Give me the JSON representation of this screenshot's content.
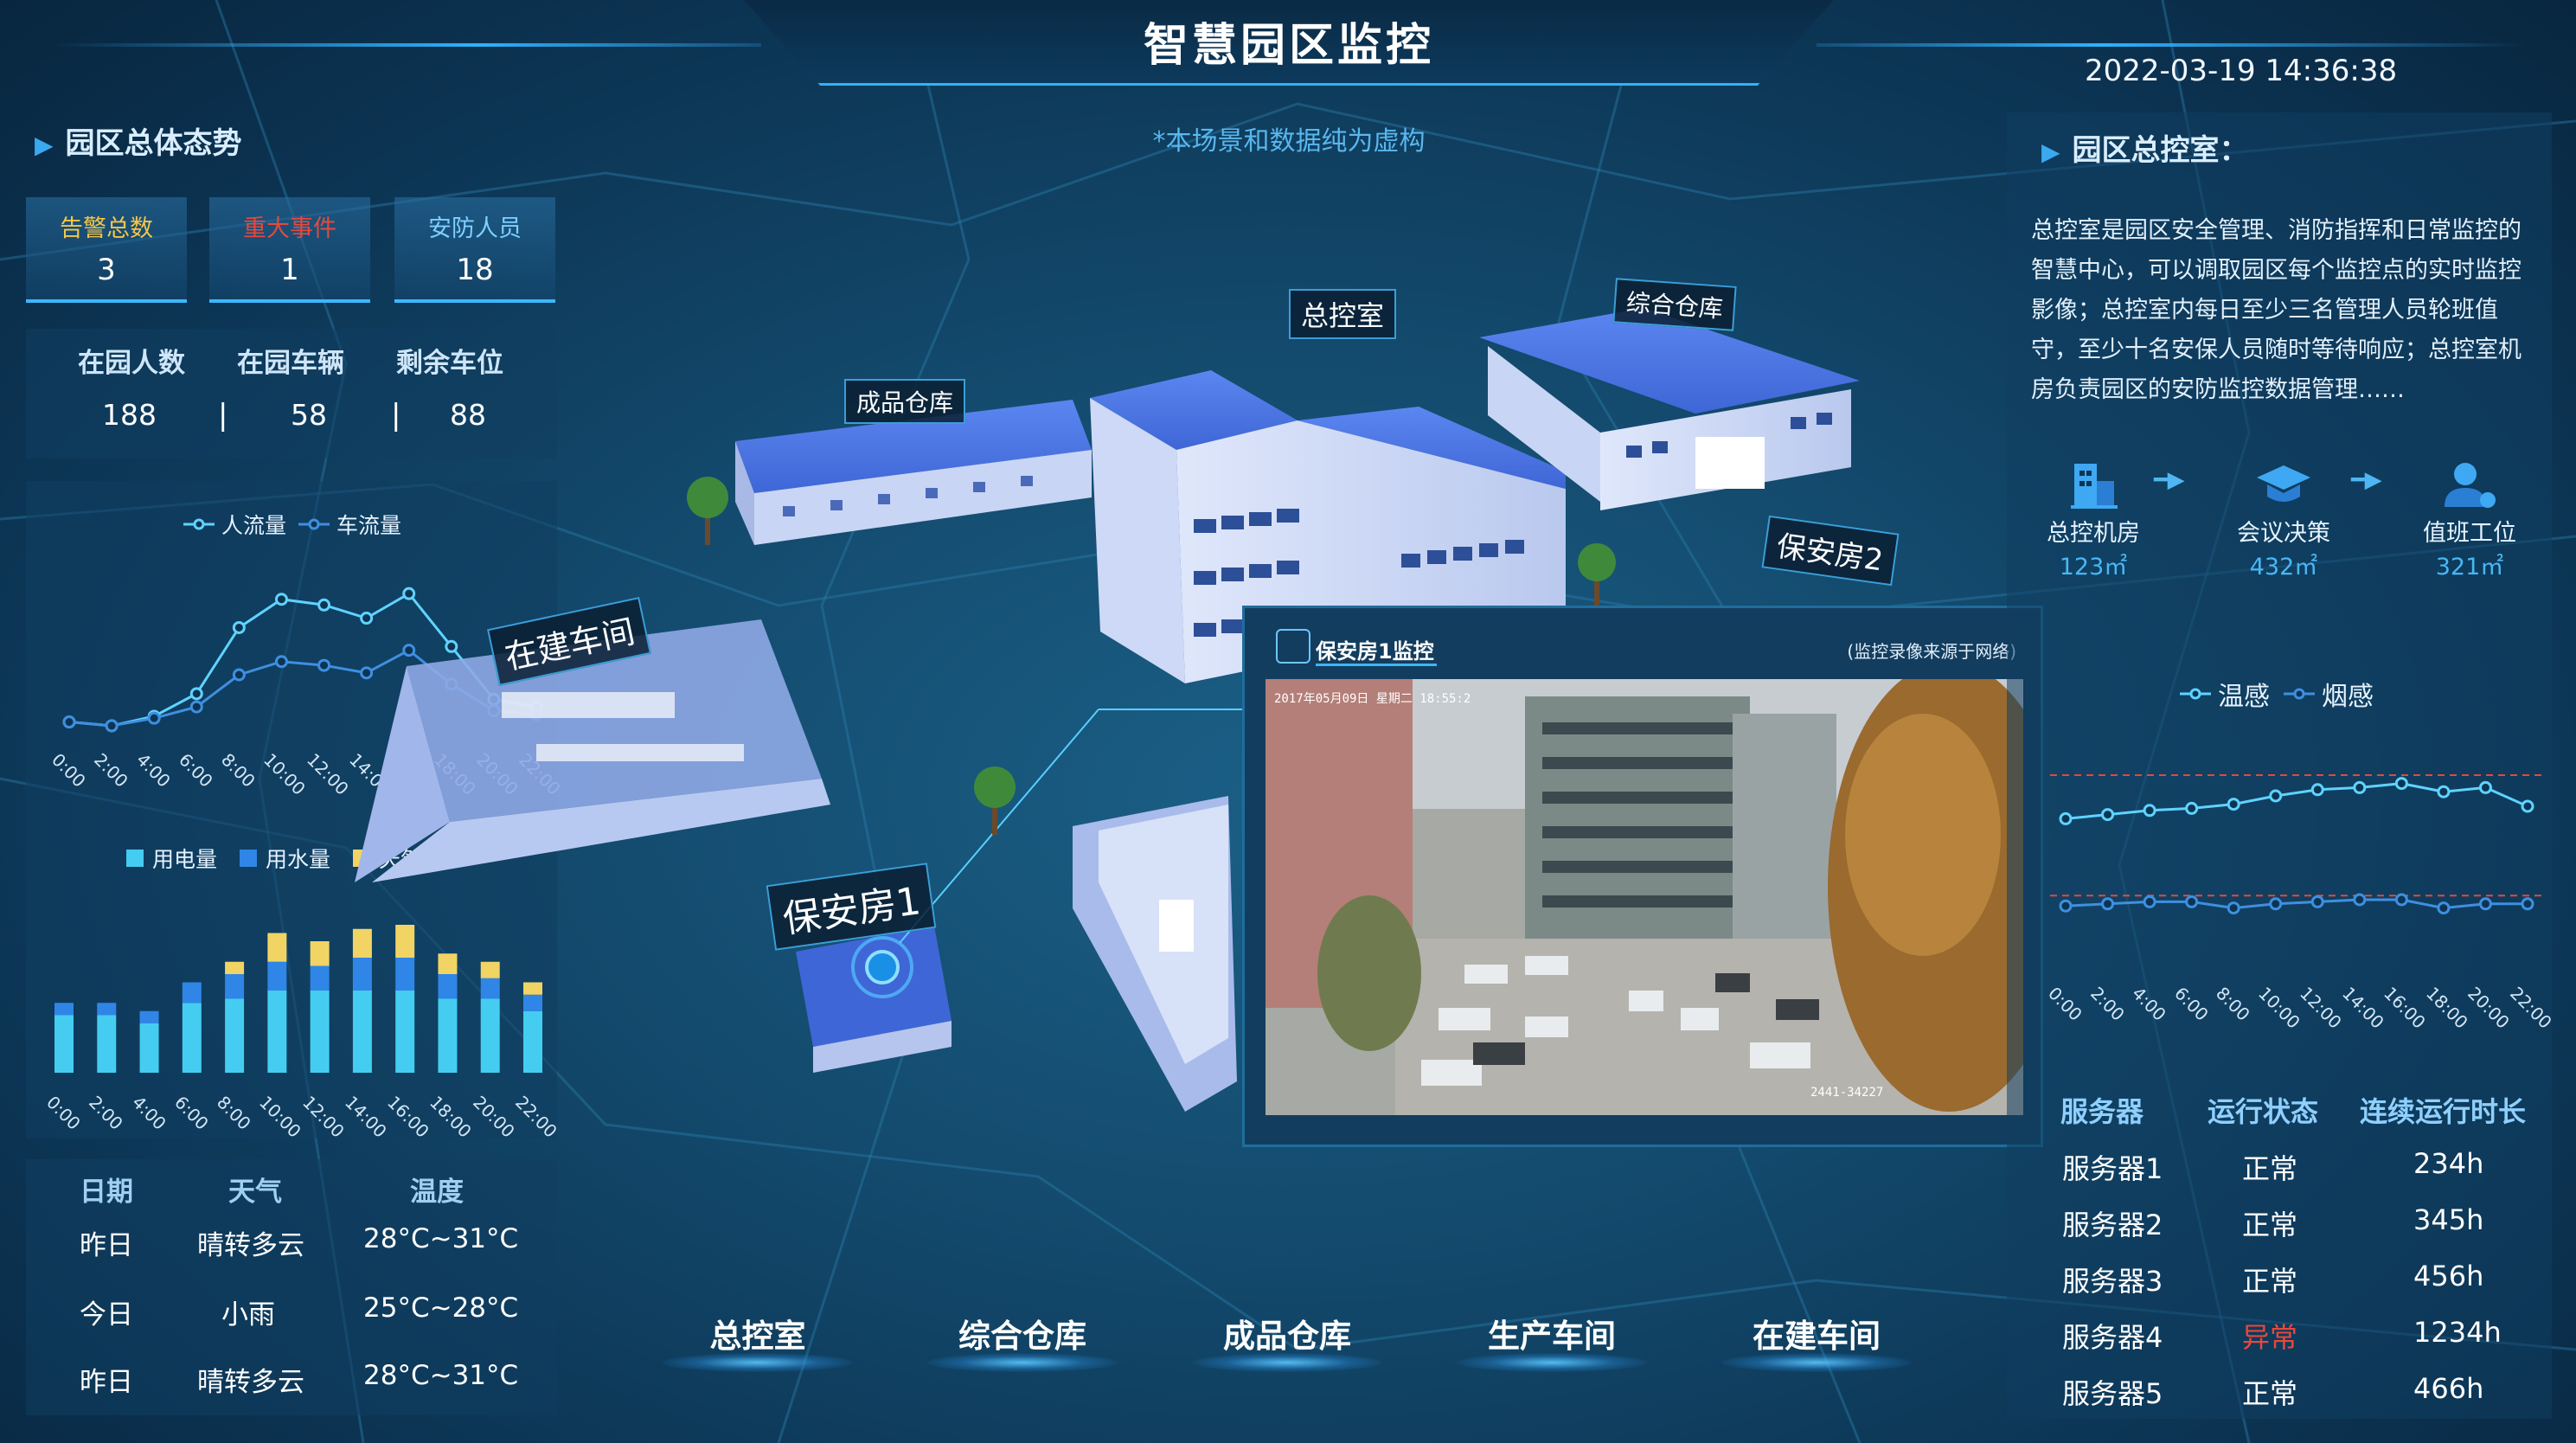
{
  "header": {
    "title": "智慧园区监控",
    "datetime": "2022-03-19 14:36:38",
    "subtitle": "*本场景和数据纯为虚构"
  },
  "left": {
    "overview_title": "园区总体态势",
    "cards": [
      {
        "label": "告警总数",
        "value": "3",
        "label_color": "#f4c64a"
      },
      {
        "label": "重大事件",
        "value": "1",
        "label_color": "#e8483c"
      },
      {
        "label": "安防人员",
        "value": "18",
        "label_color": "#7fd0ff"
      }
    ],
    "stats": [
      {
        "label": "在园人数",
        "value": "188"
      },
      {
        "label": "在园车辆",
        "value": "58"
      },
      {
        "label": "剩余车位",
        "value": "88"
      }
    ],
    "separator": "|",
    "flow_chart": {
      "legend": [
        "人流量",
        "车流量"
      ],
      "colors": [
        "#5fd3ff",
        "#3f8fe0"
      ]
    },
    "energy_chart": {
      "legend": [
        "用电量",
        "用水量",
        "天然气"
      ],
      "colors": [
        "#44cdf0",
        "#2f86e6",
        "#f1d463"
      ]
    },
    "weather": {
      "headers": [
        "日期",
        "天气",
        "温度"
      ],
      "rows": [
        [
          "昨日",
          "晴转多云",
          "28°C~31°C"
        ],
        [
          "今日",
          "小雨",
          "25°C~28°C"
        ],
        [
          "昨日",
          "晴转多云",
          "28°C~31°C"
        ]
      ]
    }
  },
  "right": {
    "title": "园区总控室：",
    "description": "总控室是园区安全管理、消防指挥和日常监控的智慧中心，可以调取园区每个监控点的实时监控影像；总控室内每日至少三名管理人员轮班值守，至少十名安保人员随时等待响应；总控室机房负责园区的安防监控数据管理……",
    "flow": [
      {
        "name": "总控机房",
        "area": "123㎡",
        "icon": "building-icon"
      },
      {
        "name": "会议决策",
        "area": "432㎡",
        "icon": "graduation-cap-icon"
      },
      {
        "name": "值班工位",
        "area": "321㎡",
        "icon": "user-icon"
      }
    ],
    "sensor_chart": {
      "legend": [
        "温感",
        "烟感"
      ],
      "colors": [
        "#5fd3ff",
        "#3f8fe0"
      ]
    },
    "servers": {
      "headers": [
        "服务器",
        "运行状态",
        "连续运行时长"
      ],
      "rows": [
        [
          "服务器1",
          "正常",
          "234h"
        ],
        [
          "服务器2",
          "正常",
          "345h"
        ],
        [
          "服务器3",
          "正常",
          "456h"
        ],
        [
          "服务器4",
          "异常",
          "1234h"
        ],
        [
          "服务器5",
          "正常",
          "466h"
        ]
      ]
    }
  },
  "scene": {
    "labels": [
      "成品仓库",
      "总控室",
      "综合仓库",
      "保安房2",
      "在建车间",
      "保安房1"
    ]
  },
  "video": {
    "title": "保安房1监控",
    "note": "(监控录像来源于网络)",
    "overlay_top": "2017年05月09日  星期二  18:55:2",
    "overlay_bottom": "2441-34227"
  },
  "nav": [
    "总控室",
    "综合仓库",
    "成品仓库",
    "生产车间",
    "在建车间"
  ],
  "chart_data": [
    {
      "type": "line",
      "categories": [
        "0:00",
        "2:00",
        "4:00",
        "6:00",
        "8:00",
        "10:00",
        "12:00",
        "14:00",
        "16:00",
        "18:00",
        "20:00",
        "22:00"
      ],
      "series": [
        {
          "name": "人流量",
          "values": [
            30,
            28,
            33,
            45,
            80,
            95,
            92,
            85,
            98,
            70,
            42,
            38
          ]
        },
        {
          "name": "车流量",
          "values": [
            30,
            28,
            32,
            38,
            55,
            62,
            60,
            56,
            68,
            50,
            36,
            34
          ]
        }
      ],
      "ylim": [
        0,
        110
      ]
    },
    {
      "type": "bar",
      "stacked": true,
      "categories": [
        "0:00",
        "2:00",
        "4:00",
        "6:00",
        "8:00",
        "10:00",
        "12:00",
        "14:00",
        "16:00",
        "18:00",
        "20:00",
        "22:00"
      ],
      "series": [
        {
          "name": "用电量",
          "values": [
            28,
            28,
            24,
            34,
            36,
            40,
            40,
            40,
            40,
            36,
            36,
            30
          ]
        },
        {
          "name": "用水量",
          "values": [
            6,
            6,
            6,
            10,
            12,
            14,
            12,
            16,
            16,
            12,
            10,
            8
          ]
        },
        {
          "name": "天然气",
          "values": [
            0,
            0,
            0,
            0,
            6,
            14,
            12,
            14,
            16,
            10,
            8,
            6
          ]
        }
      ],
      "ylim": [
        0,
        80
      ]
    },
    {
      "type": "line",
      "categories": [
        "0:00",
        "2:00",
        "4:00",
        "6:00",
        "8:00",
        "10:00",
        "12:00",
        "14:00",
        "16:00",
        "18:00",
        "20:00",
        "22:00"
      ],
      "series": [
        {
          "name": "温感",
          "values": [
            64,
            66,
            68,
            69,
            71,
            75,
            78,
            79,
            81,
            77,
            79,
            70
          ]
        },
        {
          "name": "烟感",
          "values": [
            22,
            23,
            24,
            24,
            21,
            23,
            24,
            25,
            25,
            21,
            23,
            23
          ]
        }
      ],
      "ylim": [
        0,
        100
      ],
      "threshold_lines": [
        85,
        27
      ]
    }
  ]
}
